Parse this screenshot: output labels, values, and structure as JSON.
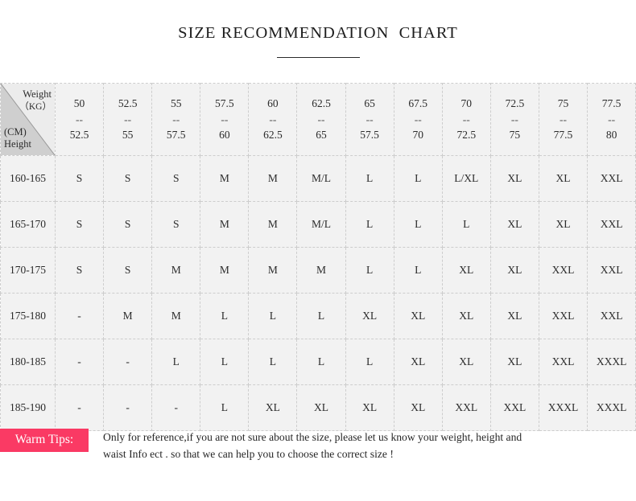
{
  "header": {
    "title": "SIZE RECOMMENDATION  CHART"
  },
  "table": {
    "corner": {
      "weight_label_line1": "Weight",
      "weight_label_line2": "（KG）",
      "height_label_line1": "(CM)",
      "height_label_line2": "Height"
    },
    "weight_columns": [
      {
        "from": "50",
        "sep": "--",
        "to": "52.5"
      },
      {
        "from": "52.5",
        "sep": "--",
        "to": "55"
      },
      {
        "from": "55",
        "sep": "--",
        "to": "57.5"
      },
      {
        "from": "57.5",
        "sep": "--",
        "to": "60"
      },
      {
        "from": "60",
        "sep": "--",
        "to": "62.5"
      },
      {
        "from": "62.5",
        "sep": "--",
        "to": "65"
      },
      {
        "from": "65",
        "sep": "--",
        "to": "57.5"
      },
      {
        "from": "67.5",
        "sep": "--",
        "to": "70"
      },
      {
        "from": "70",
        "sep": "--",
        "to": "72.5"
      },
      {
        "from": "72.5",
        "sep": "--",
        "to": "75"
      },
      {
        "from": "75",
        "sep": "--",
        "to": "77.5"
      },
      {
        "from": "77.5",
        "sep": "--",
        "to": "80"
      }
    ],
    "rows": [
      {
        "height": "160-165",
        "sizes": [
          "S",
          "S",
          "S",
          "M",
          "M",
          "M/L",
          "L",
          "L",
          "L/XL",
          "XL",
          "XL",
          "XXL"
        ]
      },
      {
        "height": "165-170",
        "sizes": [
          "S",
          "S",
          "S",
          "M",
          "M",
          "M/L",
          "L",
          "L",
          "L",
          "XL",
          "XL",
          "XXL"
        ]
      },
      {
        "height": "170-175",
        "sizes": [
          "S",
          "S",
          "M",
          "M",
          "M",
          "M",
          "L",
          "L",
          "XL",
          "XL",
          "XXL",
          "XXL"
        ]
      },
      {
        "height": "175-180",
        "sizes": [
          "-",
          "M",
          "M",
          "L",
          "L",
          "L",
          "XL",
          "XL",
          "XL",
          "XL",
          "XXL",
          "XXL"
        ]
      },
      {
        "height": "180-185",
        "sizes": [
          "-",
          "-",
          "L",
          "L",
          "L",
          "L",
          "L",
          "XL",
          "XL",
          "XL",
          "XXL",
          "XXXL"
        ]
      },
      {
        "height": "185-190",
        "sizes": [
          "-",
          "-",
          "-",
          "L",
          "XL",
          "XL",
          "XL",
          "XL",
          "XXL",
          "XXL",
          "XXXL",
          "XXXL"
        ]
      }
    ]
  },
  "tips": {
    "badge": "Warm Tips:",
    "line1": "Only for reference,if you are not sure about the size, please let us know your weight, height and",
    "line2": "waist Info ect . so that we can help you to choose the correct size !",
    "badge_color": "#fa3a64"
  },
  "colors": {
    "header_cell_bg": "#ececec",
    "row_header_bg": "#d3d3d3",
    "data_cell_bg": "#f2f2f2",
    "border": "#cdcdcd",
    "text": "#2b2b2b",
    "accent": "#fa3a64"
  }
}
